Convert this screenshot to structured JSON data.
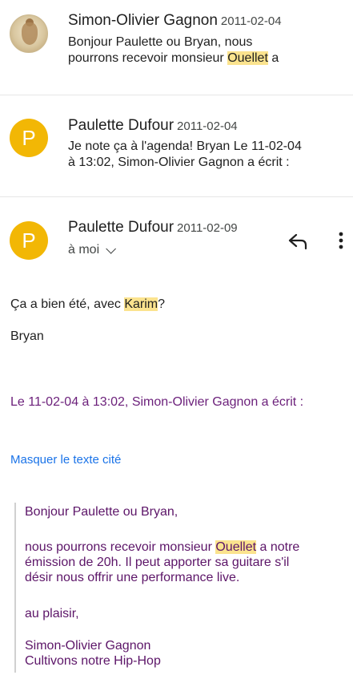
{
  "messages": [
    {
      "sender": "Simon-Olivier Gagnon",
      "date": "2011-02-04",
      "snippet_line1": "Bonjour Paulette ou Bryan, nous",
      "snippet_line2_pre": "pourrons recevoir monsieur ",
      "snippet_line2_hl": "Ouellet",
      "snippet_line2_post": " a"
    },
    {
      "sender": "Paulette Dufour",
      "date": "2011-02-04",
      "avatar_letter": "P",
      "snippet_line1": "Je note ça à l'agenda! Bryan Le 11-02-04",
      "snippet_line2": "à 13:02, Simon-Olivier Gagnon a écrit :"
    },
    {
      "sender": "Paulette Dufour",
      "date": "2011-02-09",
      "avatar_letter": "P",
      "recipient": "à moi"
    }
  ],
  "open_message": {
    "line1_pre": "Ça a bien été, avec ",
    "line1_hl": "Karim",
    "line1_post": "?",
    "signature": "Bryan",
    "quote_header": "Le 11-02-04 à 13:02, Simon-Olivier Gagnon a écrit :",
    "hide_quote_link": "Masquer le texte cité",
    "quote": {
      "greeting": "Bonjour Paulette ou Bryan,",
      "p1_pre": "nous pourrons recevoir monsieur ",
      "p1_hl": "Ouellet",
      "p1_post": " a notre",
      "p1_line2": "émission de 20h. Il peut apporter sa guitare s'il",
      "p1_line3": "désir nous offrir une performance live.",
      "closing": "au plaisir,",
      "sig_name": "Simon-Olivier Gagnon",
      "sig_tag": "Cultivons notre Hip-Hop"
    }
  },
  "colors": {
    "avatar_yellow": "#f2b705",
    "highlight": "#fbe38e",
    "quote_text": "#5c1568",
    "link": "#1a73e8"
  },
  "icons": [
    "reply-icon",
    "more-vert-icon",
    "chevron-down-icon"
  ]
}
